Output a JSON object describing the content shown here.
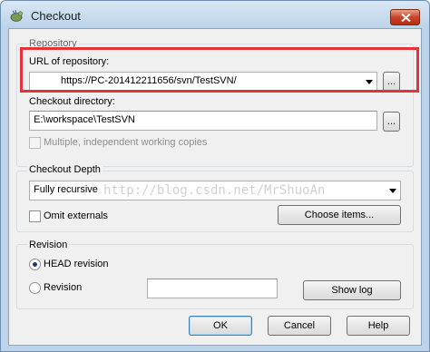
{
  "window": {
    "title": "Checkout"
  },
  "repository": {
    "group_label": "Repository",
    "url_label": "URL of repository:",
    "url_value": "https://PC-201412211656/svn/TestSVN/",
    "browse_label": "...",
    "dir_label": "Checkout directory:",
    "dir_value": "E:\\workspace\\TestSVN",
    "dir_browse_label": "...",
    "multiple_label": "Multiple, independent working copies",
    "multiple_checked": false
  },
  "depth": {
    "group_label": "Checkout Depth",
    "selected": "Fully recursive",
    "omit_label": "Omit externals",
    "omit_checked": false,
    "choose_items_label": "Choose items..."
  },
  "revision": {
    "group_label": "Revision",
    "head_label": "HEAD revision",
    "head_selected": true,
    "revision_label": "Revision",
    "revision_value": "",
    "show_log_label": "Show log"
  },
  "footer": {
    "ok_label": "OK",
    "cancel_label": "Cancel",
    "help_label": "Help"
  },
  "watermark": "http://blog.csdn.net/MrShuoAn",
  "colors": {
    "highlight": "#e53238",
    "frame": "#bcd3ea",
    "client": "#f0f0f0"
  }
}
